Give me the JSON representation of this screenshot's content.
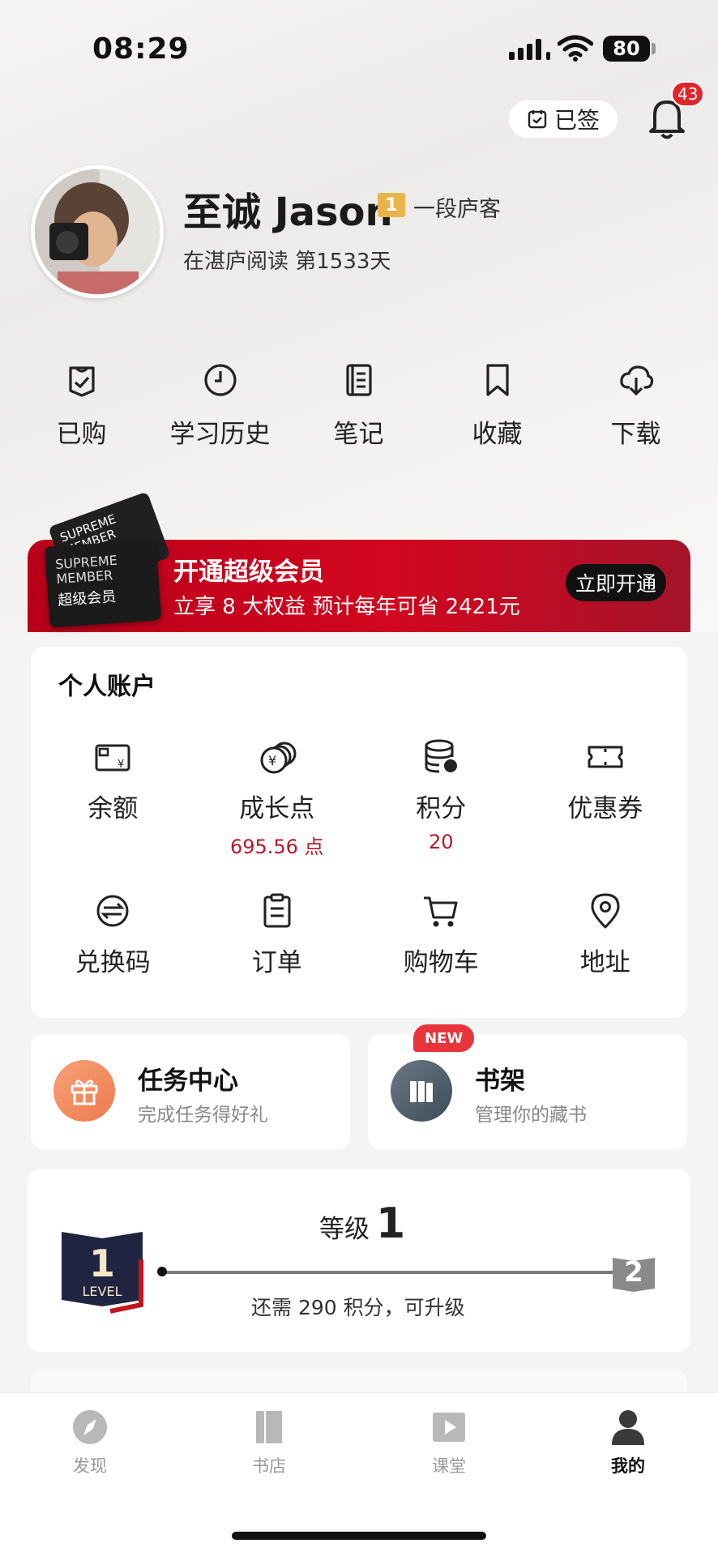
{
  "status_bar": {
    "time": "08:29",
    "battery": "80"
  },
  "header": {
    "signed_label": "已签",
    "notification_count": "43"
  },
  "profile": {
    "name": "至诚 Jason",
    "level_num": "1",
    "level_name": "一段庐客",
    "reading_days": "在湛庐阅读 第1533天"
  },
  "quick_actions": [
    {
      "label": "已购",
      "icon": "purchased-icon"
    },
    {
      "label": "学习历史",
      "icon": "history-clock-icon"
    },
    {
      "label": "笔记",
      "icon": "notes-icon"
    },
    {
      "label": "收藏",
      "icon": "bookmark-icon"
    },
    {
      "label": "下载",
      "icon": "cloud-download-icon"
    }
  ],
  "member_banner": {
    "card_top_text": "SUPREME MEMBER",
    "card_line1": "SUPREME",
    "card_line2": "MEMBER",
    "card_cn": "超级会员",
    "title": "开通超级会员",
    "subtitle": "立享 8 大权益  预计每年可省 2421元",
    "cta": "立即开通"
  },
  "account": {
    "title": "个人账户",
    "items": [
      {
        "label": "余额",
        "value": "",
        "icon": "wallet-icon"
      },
      {
        "label": "成长点",
        "value": "695.56 点",
        "icon": "coins-icon"
      },
      {
        "label": "积分",
        "value": "20",
        "icon": "points-database-icon"
      },
      {
        "label": "优惠券",
        "value": "",
        "icon": "coupon-icon"
      },
      {
        "label": "兑换码",
        "value": "",
        "icon": "redeem-code-icon"
      },
      {
        "label": "订单",
        "value": "",
        "icon": "order-clipboard-icon"
      },
      {
        "label": "购物车",
        "value": "",
        "icon": "cart-icon"
      },
      {
        "label": "地址",
        "value": "",
        "icon": "location-pin-icon"
      }
    ]
  },
  "task_center": {
    "title": "任务中心",
    "subtitle": "完成任务得好礼"
  },
  "bookshelf": {
    "badge": "NEW",
    "title": "书架",
    "subtitle": "管理你的藏书"
  },
  "level": {
    "label": "等级",
    "current": "1",
    "current_book_num": "1",
    "current_book_text": "LEVEL",
    "next": "2",
    "hint": "还需 290 积分，可升级"
  },
  "tabbar": [
    {
      "label": "发现",
      "icon": "compass-icon",
      "active": false
    },
    {
      "label": "书店",
      "icon": "bookstore-icon",
      "active": false
    },
    {
      "label": "课堂",
      "icon": "video-play-icon",
      "active": false
    },
    {
      "label": "我的",
      "icon": "profile-person-icon",
      "active": true
    }
  ],
  "colors": {
    "accent_red": "#b8192b",
    "banner_red": "#d2061f",
    "badge_gold": "#e8b54a"
  }
}
